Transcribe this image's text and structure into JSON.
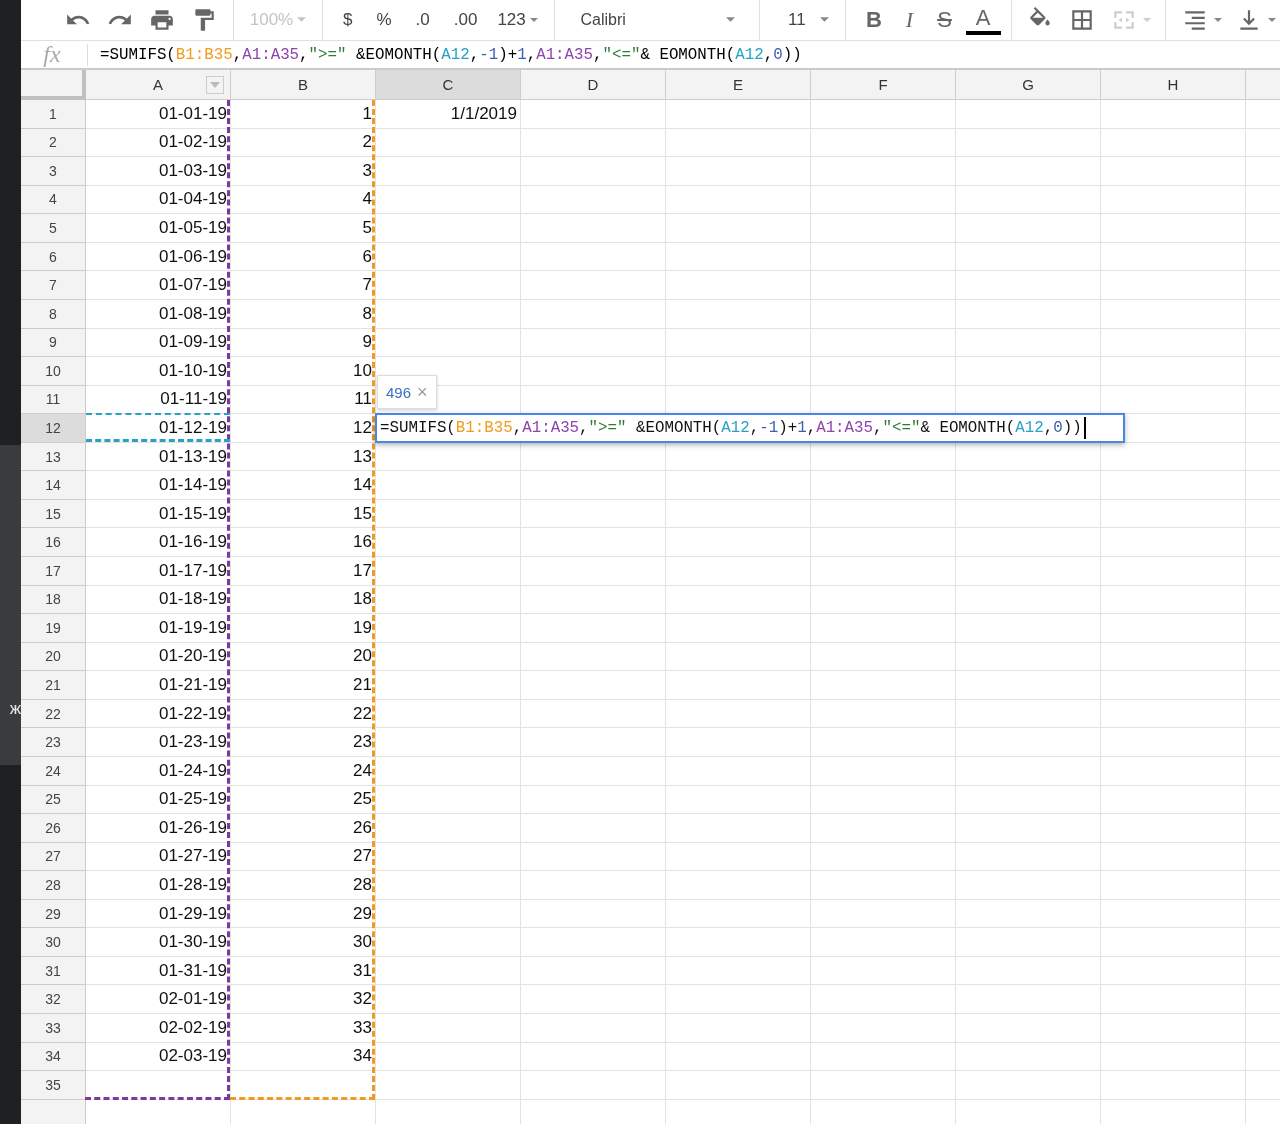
{
  "side_strip": {
    "text": "ж"
  },
  "toolbar": {
    "zoom": {
      "text": "100%",
      "disabled": true
    },
    "number_formats": [
      "$",
      "%",
      ".0",
      ".00"
    ],
    "more_formats": {
      "text": "123"
    },
    "font": {
      "text": "Calibri"
    },
    "font_size": {
      "text": "11"
    },
    "text_styles": [
      "B",
      "I",
      "S",
      "A"
    ],
    "merge_disabled": true
  },
  "formula_bar": {
    "label": "fx",
    "tokens": [
      {
        "text": "=SUMIFS("
      },
      {
        "text": "B1:B35",
        "color": "#f29b1d"
      },
      {
        "text": ","
      },
      {
        "text": "A1:A35",
        "color": "#8e44ad"
      },
      {
        "text": ","
      },
      {
        "text": "\">=\"",
        "color": "#2e7d32"
      },
      {
        "text": " &EOMONTH("
      },
      {
        "text": "A12",
        "color": "#26a2c4"
      },
      {
        "text": ","
      },
      {
        "text": "-1",
        "color": "#3c5db0"
      },
      {
        "text": ")+"
      },
      {
        "text": "1",
        "color": "#3c5db0"
      },
      {
        "text": ","
      },
      {
        "text": "A1:A35",
        "color": "#8e44ad"
      },
      {
        "text": ","
      },
      {
        "text": "\"<=\"",
        "color": "#2e7d32"
      },
      {
        "text": "& EOMONTH("
      },
      {
        "text": "A12",
        "color": "#26a2c4"
      },
      {
        "text": ","
      },
      {
        "text": "0",
        "color": "#3c5db0"
      },
      {
        "text": "))"
      }
    ]
  },
  "columns": [
    {
      "label": "A",
      "filter": true,
      "color": "#7d3a9e",
      "selected": false
    },
    {
      "label": "B",
      "filter": false,
      "color": "#f09a24",
      "selected": false
    },
    {
      "label": "C",
      "filter": false,
      "selected": true
    },
    {
      "label": "D",
      "filter": false,
      "selected": false
    },
    {
      "label": "E",
      "filter": false,
      "selected": false
    },
    {
      "label": "F",
      "filter": false,
      "selected": false
    },
    {
      "label": "G",
      "filter": false,
      "selected": false
    },
    {
      "label": "H",
      "filter": false,
      "selected": false
    }
  ],
  "rows": [
    {
      "label": "1",
      "cells": [
        "01-01-19",
        "1",
        "1/1/2019"
      ]
    },
    {
      "label": "2",
      "cells": [
        "01-02-19",
        "2"
      ]
    },
    {
      "label": "3",
      "cells": [
        "01-03-19",
        "3"
      ]
    },
    {
      "label": "4",
      "cells": [
        "01-04-19",
        "4"
      ]
    },
    {
      "label": "5",
      "cells": [
        "01-05-19",
        "5"
      ]
    },
    {
      "label": "6",
      "cells": [
        "01-06-19",
        "6"
      ]
    },
    {
      "label": "7",
      "cells": [
        "01-07-19",
        "7"
      ]
    },
    {
      "label": "8",
      "cells": [
        "01-08-19",
        "8"
      ]
    },
    {
      "label": "9",
      "cells": [
        "01-09-19",
        "9"
      ]
    },
    {
      "label": "10",
      "cells": [
        "01-10-19",
        "10"
      ]
    },
    {
      "label": "11",
      "cells": [
        "01-11-19",
        "11"
      ]
    },
    {
      "label": "12",
      "cells": [
        "01-12-19",
        "12"
      ],
      "referenced": true,
      "color": "#26a2c4",
      "editing": true
    },
    {
      "label": "13",
      "cells": [
        "01-13-19",
        "13"
      ]
    },
    {
      "label": "14",
      "cells": [
        "01-14-19",
        "14"
      ]
    },
    {
      "label": "15",
      "cells": [
        "01-15-19",
        "15"
      ]
    },
    {
      "label": "16",
      "cells": [
        "01-16-19",
        "16"
      ]
    },
    {
      "label": "17",
      "cells": [
        "01-17-19",
        "17"
      ]
    },
    {
      "label": "18",
      "cells": [
        "01-18-19",
        "18"
      ]
    },
    {
      "label": "19",
      "cells": [
        "01-19-19",
        "19"
      ]
    },
    {
      "label": "20",
      "cells": [
        "01-20-19",
        "20"
      ]
    },
    {
      "label": "21",
      "cells": [
        "01-21-19",
        "21"
      ]
    },
    {
      "label": "22",
      "cells": [
        "01-22-19",
        "22"
      ]
    },
    {
      "label": "23",
      "cells": [
        "01-23-19",
        "23"
      ]
    },
    {
      "label": "24",
      "cells": [
        "01-24-19",
        "24"
      ]
    },
    {
      "label": "25",
      "cells": [
        "01-25-19",
        "25"
      ]
    },
    {
      "label": "26",
      "cells": [
        "01-26-19",
        "26"
      ]
    },
    {
      "label": "27",
      "cells": [
        "01-27-19",
        "27"
      ]
    },
    {
      "label": "28",
      "cells": [
        "01-28-19",
        "28"
      ]
    },
    {
      "label": "29",
      "cells": [
        "01-29-19",
        "29"
      ]
    },
    {
      "label": "30",
      "cells": [
        "01-30-19",
        "30"
      ]
    },
    {
      "label": "31",
      "cells": [
        "01-31-19",
        "31"
      ]
    },
    {
      "label": "32",
      "cells": [
        "02-01-19",
        "32"
      ]
    },
    {
      "label": "33",
      "cells": [
        "02-02-19",
        "33"
      ]
    },
    {
      "label": "34",
      "cells": [
        "02-03-19",
        "34"
      ]
    },
    {
      "label": "35",
      "cells": []
    }
  ],
  "cell_editor": {
    "tooltip": "496",
    "close": "×",
    "tokens": [
      {
        "text": "=SUMIFS("
      },
      {
        "text": "B1:B35",
        "color": "#f29b1d"
      },
      {
        "text": ","
      },
      {
        "text": "A1:A35",
        "color": "#8e44ad"
      },
      {
        "text": ","
      },
      {
        "text": "\">=\"",
        "color": "#2e7d32"
      },
      {
        "text": " &EOMONTH("
      },
      {
        "text": "A12",
        "color": "#26a2c4"
      },
      {
        "text": ","
      },
      {
        "text": "-1",
        "color": "#3c5db0"
      },
      {
        "text": ")+"
      },
      {
        "text": "1",
        "color": "#3c5db0"
      },
      {
        "text": ","
      },
      {
        "text": "A1:A35",
        "color": "#8e44ad"
      },
      {
        "text": ","
      },
      {
        "text": "\"<=\"",
        "color": "#2e7d32"
      },
      {
        "text": "& EOMONTH("
      },
      {
        "text": "A12",
        "color": "#26a2c4"
      },
      {
        "text": ","
      },
      {
        "text": "0",
        "color": "#3c5db0"
      },
      {
        "text": "))"
      }
    ]
  }
}
